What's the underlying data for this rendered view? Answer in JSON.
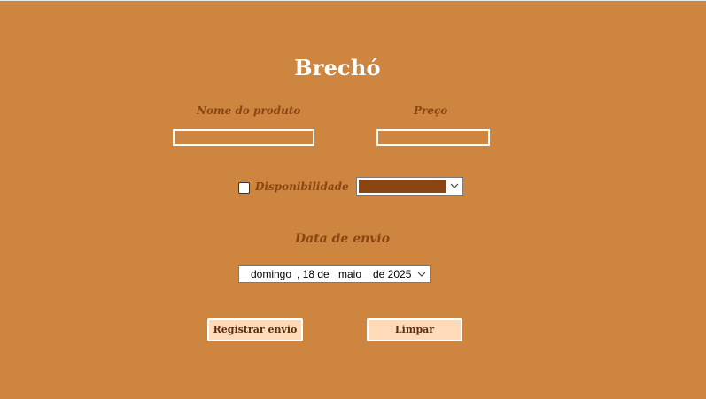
{
  "window": {
    "title": "Brechó",
    "background_color": "#cd853f"
  },
  "form": {
    "nome_label": "Nome do produto",
    "nome_value": "",
    "preco_label": "Preço",
    "preco_value": "",
    "disponibilidade_label": "Disponibilidade",
    "disponibilidade_checked": false,
    "color_combo": {
      "selected_color": "#8b4513"
    },
    "data_label": "Data de envio",
    "date_picker": {
      "weekday": "domingo",
      "day": ", 18 de",
      "month": "maio",
      "year": "de 2025"
    }
  },
  "buttons": {
    "registrar_label": "Registrar envio",
    "limpar_label": "Limpar"
  },
  "colors": {
    "label_color": "#8b4513",
    "button_background": "#ffdab9",
    "title_color": "#ffffff"
  }
}
